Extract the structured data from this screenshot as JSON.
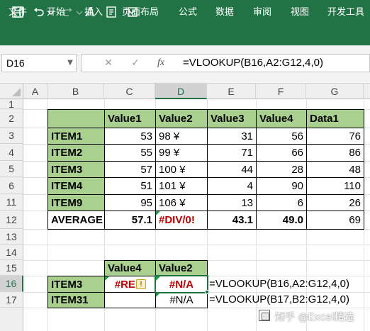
{
  "ribbon": {
    "tabs": [
      "文件",
      "开始",
      "插入",
      "页面布局",
      "公式",
      "数据",
      "审阅",
      "视图",
      "开发工具"
    ]
  },
  "formula_bar": {
    "name_box": "D16",
    "formula": "=VLOOKUP(B16,A2:G12,4,0)",
    "fx_label": "fx"
  },
  "columns": [
    "A",
    "B",
    "C",
    "D",
    "E",
    "F",
    "G"
  ],
  "rows": [
    "1",
    "2",
    "3",
    "4",
    "5",
    "6",
    "11",
    "12",
    "13",
    "14",
    "15",
    "16",
    "17"
  ],
  "table": {
    "headers": [
      "",
      "Value1",
      "Value2",
      "Value3",
      "Value4",
      "Data1"
    ],
    "rows": [
      [
        "ITEM1",
        "53",
        "98 ¥",
        "31",
        "56",
        "76"
      ],
      [
        "ITEM2",
        "55",
        "99 ¥",
        "71",
        "66",
        "86"
      ],
      [
        "ITEM3",
        "57",
        "100 ¥",
        "44",
        "28",
        "48"
      ],
      [
        "ITEM4",
        "51",
        "101 ¥",
        "4",
        "90",
        "110"
      ],
      [
        "ITEM9",
        "95",
        "106 ¥",
        "13",
        "6",
        "26"
      ]
    ],
    "average": [
      "AVERAGE",
      "57.1",
      "#DIV/0!",
      "43.1",
      "49.0",
      "69"
    ]
  },
  "lookup": {
    "headers": [
      "Value4",
      "Value2"
    ],
    "rows": [
      {
        "item": "ITEM3",
        "c": "#REF!",
        "d": "#N/A",
        "formula": "=VLOOKUP(B16,A2:G12,4,0)"
      },
      {
        "item": "ITEM31",
        "c": "",
        "d": "#N/A",
        "formula": "=VLOOKUP(B17,B2:G12,4,0)"
      }
    ]
  },
  "error_badge": "!",
  "watermark": "知乎 @Excel精选",
  "colors": {
    "excel_green": "#217346",
    "header_fill": "#a9d08e",
    "error_red": "#c00000"
  }
}
